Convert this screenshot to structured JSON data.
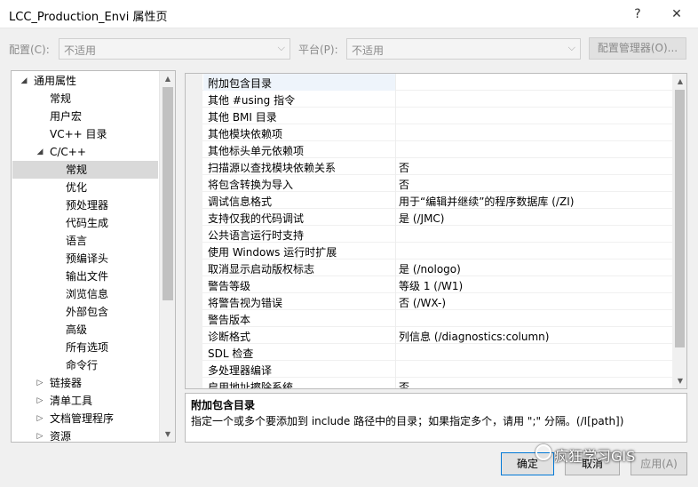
{
  "window": {
    "title": "LCC_Production_Envi 属性页",
    "help": "?",
    "close": "✕"
  },
  "config": {
    "label": "配置(C):",
    "value": "不适用"
  },
  "platform": {
    "label": "平台(P):",
    "value": "不适用"
  },
  "config_manager": "配置管理器(O)...",
  "tree": [
    {
      "label": "通用属性",
      "level": 0,
      "toggle": "◢",
      "selected": false
    },
    {
      "label": "常规",
      "level": 1,
      "toggle": "",
      "selected": false
    },
    {
      "label": "用户宏",
      "level": 1,
      "toggle": "",
      "selected": false
    },
    {
      "label": "VC++ 目录",
      "level": 1,
      "toggle": "",
      "selected": false
    },
    {
      "label": "C/C++",
      "level": 1,
      "toggle": "◢",
      "selected": false
    },
    {
      "label": "常规",
      "level": 2,
      "toggle": "",
      "selected": true
    },
    {
      "label": "优化",
      "level": 2,
      "toggle": "",
      "selected": false
    },
    {
      "label": "预处理器",
      "level": 2,
      "toggle": "",
      "selected": false
    },
    {
      "label": "代码生成",
      "level": 2,
      "toggle": "",
      "selected": false
    },
    {
      "label": "语言",
      "level": 2,
      "toggle": "",
      "selected": false
    },
    {
      "label": "预编译头",
      "level": 2,
      "toggle": "",
      "selected": false
    },
    {
      "label": "输出文件",
      "level": 2,
      "toggle": "",
      "selected": false
    },
    {
      "label": "浏览信息",
      "level": 2,
      "toggle": "",
      "selected": false
    },
    {
      "label": "外部包含",
      "level": 2,
      "toggle": "",
      "selected": false
    },
    {
      "label": "高级",
      "level": 2,
      "toggle": "",
      "selected": false
    },
    {
      "label": "所有选项",
      "level": 2,
      "toggle": "",
      "selected": false
    },
    {
      "label": "命令行",
      "level": 2,
      "toggle": "",
      "selected": false
    },
    {
      "label": "链接器",
      "level": 1,
      "toggle": "▷",
      "selected": false
    },
    {
      "label": "清单工具",
      "level": 1,
      "toggle": "▷",
      "selected": false
    },
    {
      "label": "文档管理程序",
      "level": 1,
      "toggle": "▷",
      "selected": false
    },
    {
      "label": "资源",
      "level": 1,
      "toggle": "▷",
      "selected": false
    }
  ],
  "properties": [
    {
      "name": "附加包含目录",
      "value": ""
    },
    {
      "name": "其他 #using 指令",
      "value": ""
    },
    {
      "name": "其他 BMI 目录",
      "value": ""
    },
    {
      "name": "其他模块依赖项",
      "value": ""
    },
    {
      "name": "其他标头单元依赖项",
      "value": ""
    },
    {
      "name": "扫描源以查找模块依赖关系",
      "value": "否"
    },
    {
      "name": "将包含转换为导入",
      "value": "否"
    },
    {
      "name": "调试信息格式",
      "value": "用于“编辑并继续”的程序数据库 (/ZI)"
    },
    {
      "name": "支持仅我的代码调试",
      "value": "是 (/JMC)"
    },
    {
      "name": "公共语言运行时支持",
      "value": ""
    },
    {
      "name": "使用 Windows 运行时扩展",
      "value": ""
    },
    {
      "name": "取消显示启动版权标志",
      "value": "是 (/nologo)"
    },
    {
      "name": "警告等级",
      "value": "等级 1 (/W1)"
    },
    {
      "name": "将警告视为错误",
      "value": "否 (/WX-)"
    },
    {
      "name": "警告版本",
      "value": ""
    },
    {
      "name": "诊断格式",
      "value": "列信息 (/diagnostics:column)"
    },
    {
      "name": "SDL 检查",
      "value": ""
    },
    {
      "name": "多处理器编译",
      "value": ""
    },
    {
      "name": "启用地址擦除系统",
      "value": "否"
    }
  ],
  "description": {
    "title": "附加包含目录",
    "text": "指定一个或多个要添加到 include 路径中的目录；如果指定多个，请用 \";\" 分隔。(/I[path])"
  },
  "buttons": {
    "ok": "确定",
    "cancel": "取消",
    "apply": "应用(A)"
  },
  "watermark": "疯狂学习GIS",
  "icons": {
    "up": "▲",
    "down": "▼",
    "combo": "⌵"
  }
}
